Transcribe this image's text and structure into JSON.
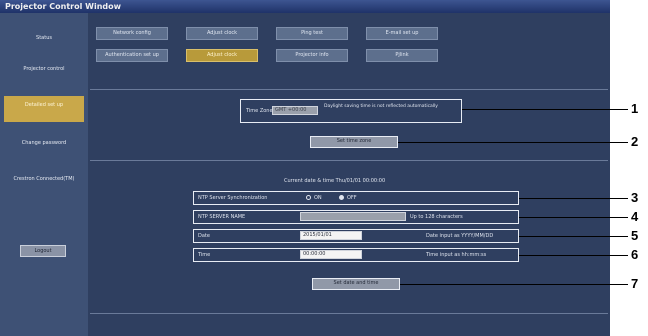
{
  "window": {
    "title": "Projector Control Window"
  },
  "sidebar": {
    "items": [
      {
        "label": "Status"
      },
      {
        "label": "Projector control"
      },
      {
        "label": "Detailed set up"
      },
      {
        "label": "Change password"
      },
      {
        "label": "Crestron Connected(TM)"
      }
    ],
    "logout_label": "Logout"
  },
  "tabs": [
    {
      "label": "Network config"
    },
    {
      "label": "Adjust clock"
    },
    {
      "label": "Ping test"
    },
    {
      "label": "E-mail set up"
    },
    {
      "label": "Authentication set up"
    },
    {
      "label": "Adjust clock"
    },
    {
      "label": "Projector info"
    },
    {
      "label": "Pjlink"
    }
  ],
  "clock": {
    "time_zone_label": "Time Zone",
    "time_zone_value": "GMT +00:00",
    "time_zone_note": "Daylight saving time is not reflected automatically",
    "set_button": "Set time zone",
    "current_datetime": "Current date & time Thu/01/01 00:00:00"
  },
  "ntp": {
    "sync_label": "NTP Server Synchronization",
    "option_on": "ON",
    "option_off": "OFF",
    "selected": "OFF",
    "server_label": "NTP SERVER NAME",
    "server_value": "",
    "server_note": "Up to 128 characters"
  },
  "date": {
    "label": "Date",
    "value": "2015/01/01",
    "note": "Date input as YYYY/MM/DD"
  },
  "time": {
    "label": "Time",
    "value": "00:00:00",
    "note": "Time input as hh:mm:ss"
  },
  "set_datetime_button": "Set date and time",
  "callouts": [
    "1",
    "2",
    "3",
    "4",
    "5",
    "6",
    "7"
  ]
}
